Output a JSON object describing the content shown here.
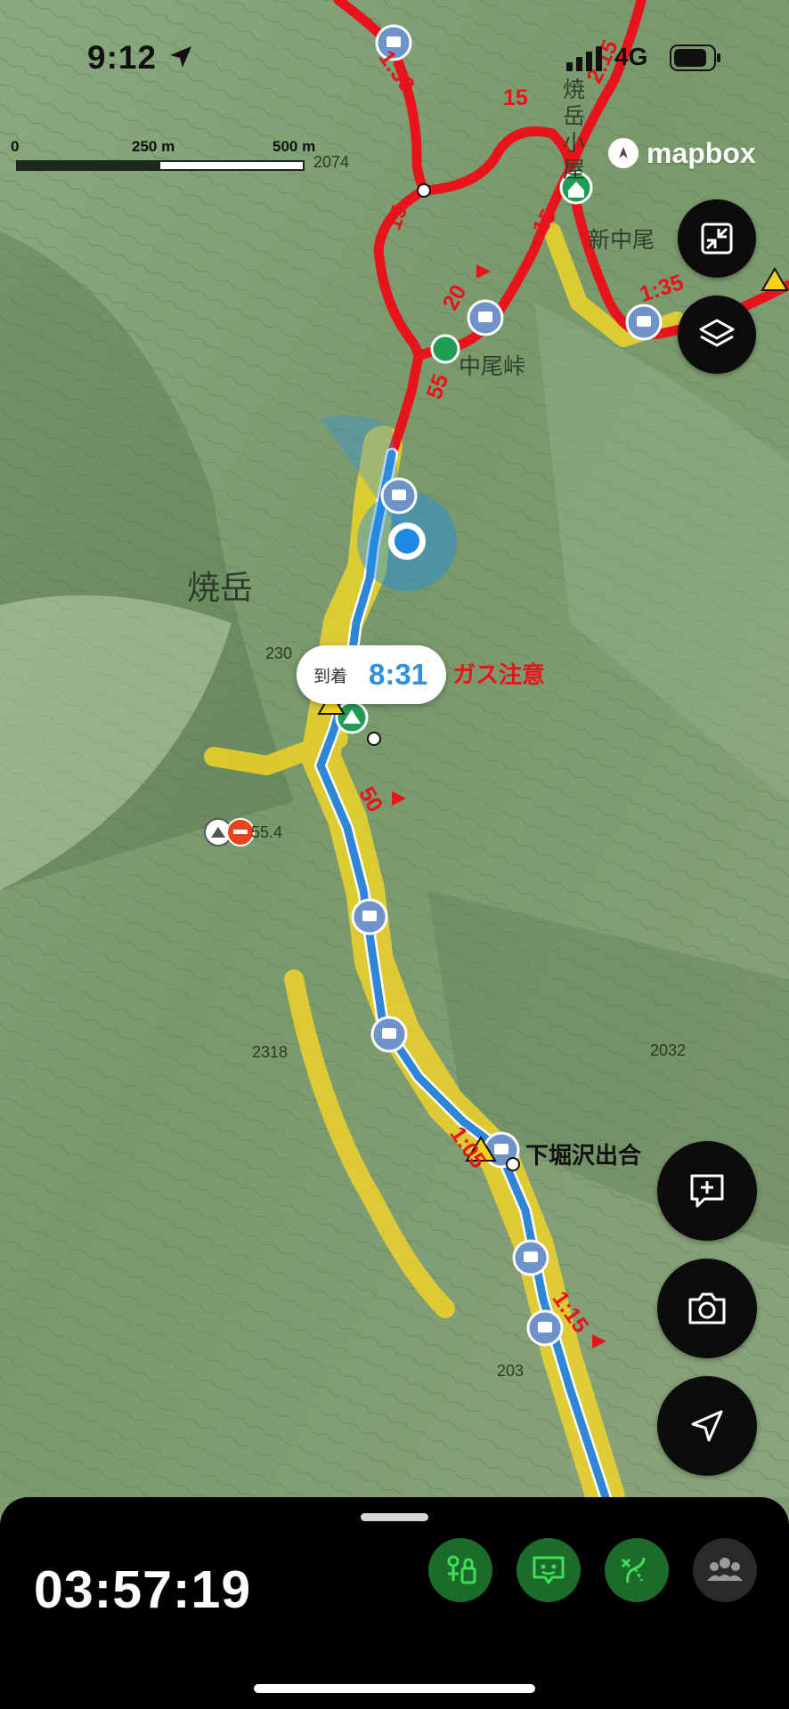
{
  "status_bar": {
    "time": "9:12",
    "network": "4G",
    "icons": [
      "location-arrow-icon",
      "signal-bars-icon",
      "battery-icon"
    ]
  },
  "map": {
    "attribution": "mapbox",
    "scale": {
      "labels": [
        "0",
        "250 m",
        "500 m"
      ]
    },
    "colors": {
      "route_planned": "#e8131b",
      "track_recorded": "#2f86d6",
      "track_halo": "#f2d21e",
      "position": "#1e8fe6"
    },
    "elevations": [
      "2074",
      "2318",
      "2032",
      "55.4",
      "230",
      "203"
    ],
    "place_names": [
      "焼岳",
      "中尾峠",
      "新中尾",
      "焼岳小屋"
    ],
    "time_labels": [
      "1:50",
      "15",
      "2:15",
      "15",
      "15",
      "20",
      "55",
      "1:35",
      "50",
      "1:05",
      "1:15"
    ],
    "arrival": {
      "label": "到着",
      "time": "8:31"
    },
    "warnings": {
      "gas": "ガス注意",
      "shimohori": "下堀沢出合"
    }
  },
  "controls": {
    "fit": "fullscreen-shrink-icon",
    "layers": "layers-icon",
    "add_note": "add-note-icon",
    "camera": "camera-icon",
    "locate": "navigation-arrow-icon"
  },
  "bottom_panel": {
    "elapsed_time": "03:57:19",
    "buttons": [
      {
        "name": "route-lock-icon",
        "active": true
      },
      {
        "name": "message-icon",
        "active": true
      },
      {
        "name": "route-branch-icon",
        "active": true
      },
      {
        "name": "group-icon",
        "active": false
      }
    ],
    "active_color": "#1c6b2a",
    "active_icon_color": "#3ee05a",
    "inactive_color": "#2a2a2a"
  }
}
